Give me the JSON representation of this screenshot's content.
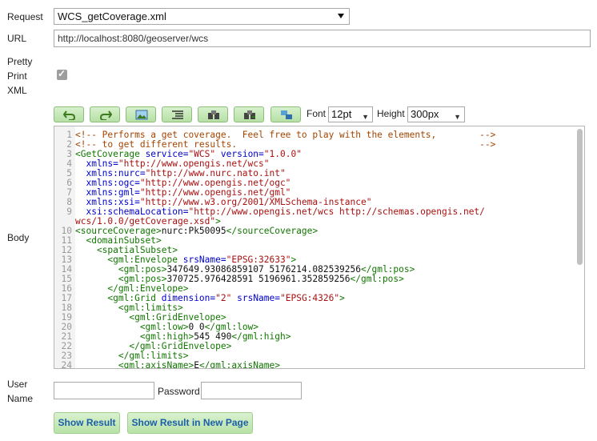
{
  "form": {
    "request_label": "Request",
    "request_value": "WCS_getCoverage.xml",
    "url_label": "URL",
    "url_value": "http://localhost:8080/geoserver/wcs",
    "pretty_label_1": "Pretty",
    "pretty_label_2": "Print",
    "pretty_label_3": "XML",
    "pretty_checked": true,
    "font_label": "Font",
    "font_value": "12pt",
    "height_label": "Height",
    "height_value": "300px",
    "body_label": "Body",
    "username_label_1": "User",
    "username_label_2": "Name",
    "password_label": "Password",
    "show_result": "Show Result",
    "show_result_new": "Show Result in New Page"
  },
  "toolbar": {
    "buttons": [
      "undo-icon",
      "redo-icon",
      "image-icon",
      "reindent-icon",
      "find-icon",
      "find-next-icon",
      "replace-icon"
    ]
  },
  "editor": {
    "line_numbers": [
      "1",
      "2",
      "3",
      "4",
      "5",
      "6",
      "7",
      "8",
      "9",
      "",
      "10",
      "11",
      "12",
      "13",
      "14",
      "15",
      "16",
      "17",
      "18",
      "19",
      "20",
      "21",
      "22",
      "23",
      "24"
    ],
    "lines": [
      [
        [
          "c",
          "<!-- Performs a get coverage.  Feel free to play with the elements,        -->"
        ]
      ],
      [
        [
          "c",
          "<!-- to get different results.                                             -->"
        ]
      ],
      [
        [
          "t",
          "<GetCoverage "
        ],
        [
          "a",
          "service="
        ],
        [
          "v",
          "\"WCS\""
        ],
        [
          "t",
          " "
        ],
        [
          "a",
          "version="
        ],
        [
          "v",
          "\"1.0.0\""
        ],
        [
          "t",
          ""
        ]
      ],
      [
        [
          "a",
          "  xmlns="
        ],
        [
          "v",
          "\"http://www.opengis.net/wcs\""
        ]
      ],
      [
        [
          "a",
          "  xmlns:nurc="
        ],
        [
          "v",
          "\"http://www.nurc.nato.int\""
        ]
      ],
      [
        [
          "a",
          "  xmlns:ogc="
        ],
        [
          "v",
          "\"http://www.opengis.net/ogc\""
        ]
      ],
      [
        [
          "a",
          "  xmlns:gml="
        ],
        [
          "v",
          "\"http://www.opengis.net/gml\""
        ]
      ],
      [
        [
          "a",
          "  xmlns:xsi="
        ],
        [
          "v",
          "\"http://www.w3.org/2001/XMLSchema-instance\""
        ]
      ],
      [
        [
          "a",
          "  xsi:schemaLocation="
        ],
        [
          "v",
          "\"http://www.opengis.net/wcs http://schemas.opengis.net/"
        ]
      ],
      [
        [
          "v",
          "wcs/1.0.0/getCoverage.xsd\""
        ],
        [
          "t",
          ">"
        ]
      ],
      [
        [
          "t",
          "<sourceCoverage>"
        ],
        [
          "x",
          "nurc:Pk50095"
        ],
        [
          "t",
          "</sourceCoverage>"
        ]
      ],
      [
        [
          "t",
          "  <domainSubset>"
        ]
      ],
      [
        [
          "t",
          "    <spatialSubset>"
        ]
      ],
      [
        [
          "t",
          "      <gml:Envelope "
        ],
        [
          "a",
          "srsName="
        ],
        [
          "v",
          "\"EPSG:32633\""
        ],
        [
          "t",
          ">"
        ]
      ],
      [
        [
          "t",
          "        <gml:pos>"
        ],
        [
          "x",
          "347649.93086859107 5176214.082539256"
        ],
        [
          "t",
          "</gml:pos>"
        ]
      ],
      [
        [
          "t",
          "        <gml:pos>"
        ],
        [
          "x",
          "370725.976428591 5196961.352859256"
        ],
        [
          "t",
          "</gml:pos>"
        ]
      ],
      [
        [
          "t",
          "      </gml:Envelope>"
        ]
      ],
      [
        [
          "t",
          "      <gml:Grid "
        ],
        [
          "a",
          "dimension="
        ],
        [
          "v",
          "\"2\""
        ],
        [
          "t",
          " "
        ],
        [
          "a",
          "srsName="
        ],
        [
          "v",
          "\"EPSG:4326\""
        ],
        [
          "t",
          ">"
        ]
      ],
      [
        [
          "t",
          "        <gml:limits>"
        ]
      ],
      [
        [
          "t",
          "          <gml:GridEnvelope>"
        ]
      ],
      [
        [
          "t",
          "            <gml:low>"
        ],
        [
          "x",
          "0 0"
        ],
        [
          "t",
          "</gml:low>"
        ]
      ],
      [
        [
          "t",
          "            <gml:high>"
        ],
        [
          "x",
          "545 490"
        ],
        [
          "t",
          "</gml:high>"
        ]
      ],
      [
        [
          "t",
          "          </gml:GridEnvelope>"
        ]
      ],
      [
        [
          "t",
          "        </gml:limits>"
        ]
      ],
      [
        [
          "t",
          "        <gml:axisName>"
        ],
        [
          "x",
          "E"
        ],
        [
          "t",
          "</gml:axisName>"
        ]
      ]
    ]
  }
}
